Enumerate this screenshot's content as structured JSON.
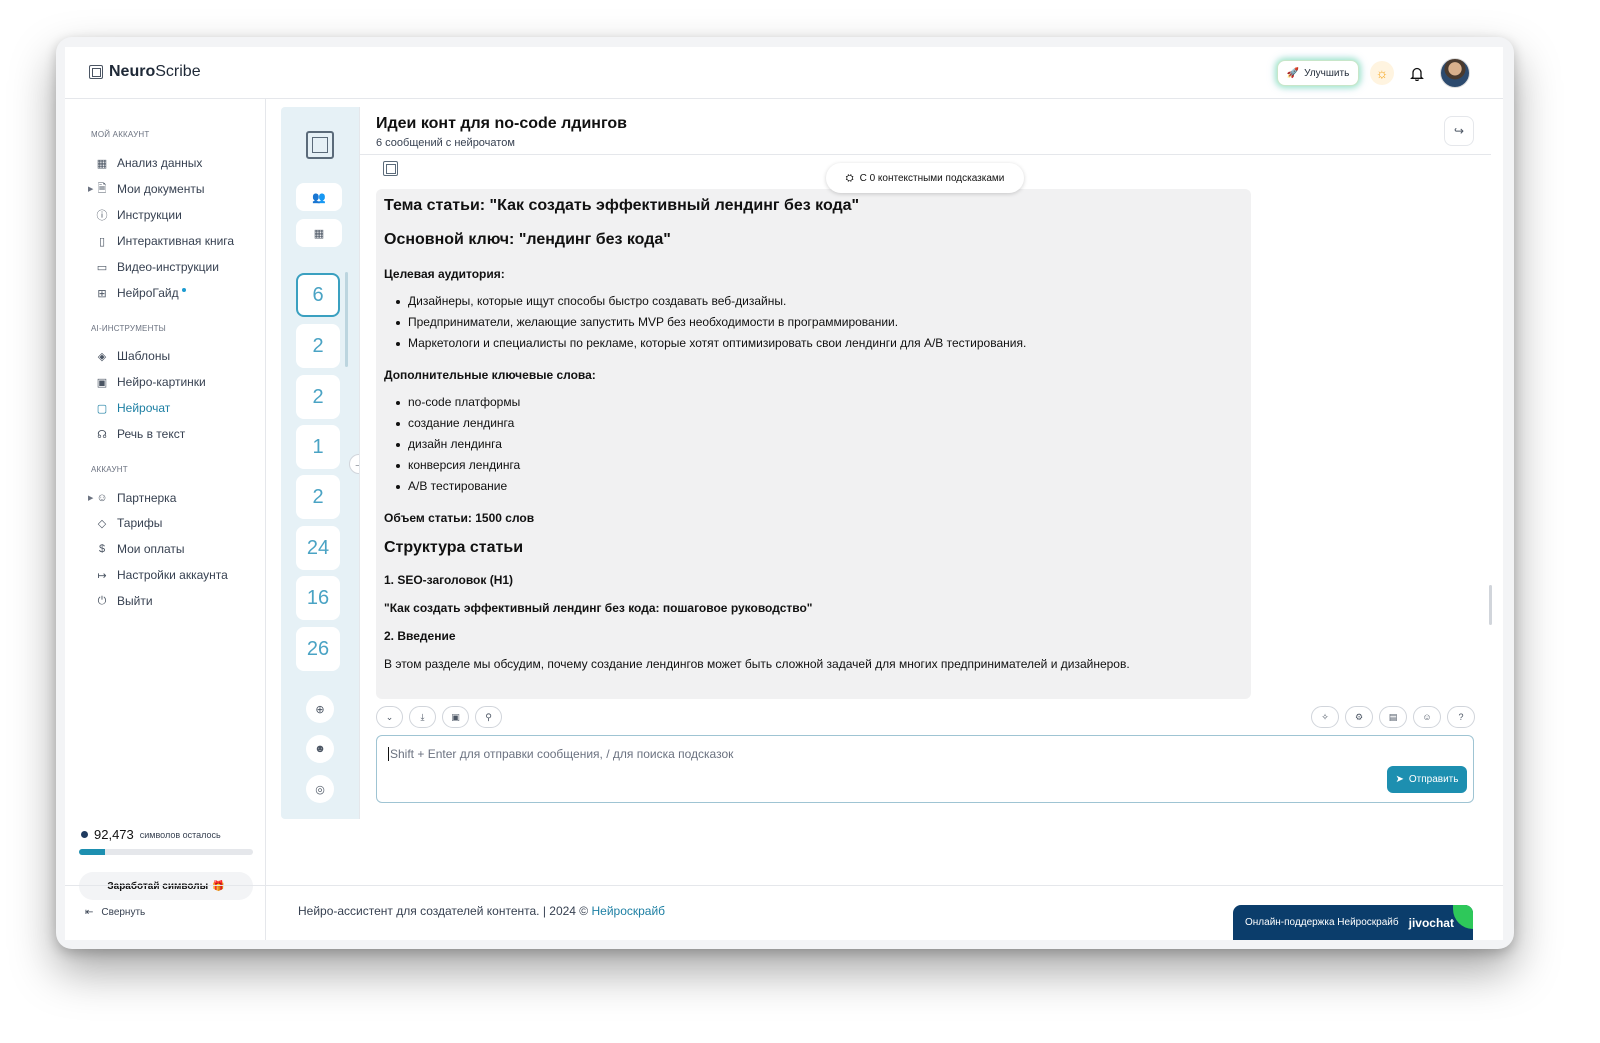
{
  "app": {
    "brand_bold": "Neuro",
    "brand_light": "Scribe",
    "upgrade_label": "Улучшить"
  },
  "sidebar": {
    "sections": [
      {
        "title": "МОЙ АККАУНТ",
        "items": [
          {
            "label": "Анализ данных",
            "icon": "grid-icon"
          },
          {
            "label": "Мои документы",
            "icon": "document-icon",
            "expandable": true
          },
          {
            "label": "Инструкции",
            "icon": "help-circle-icon"
          },
          {
            "label": "Интерактивная книга",
            "icon": "book-icon"
          },
          {
            "label": "Видео-инструкции",
            "icon": "video-icon"
          },
          {
            "label": "НейроГайд",
            "icon": "table-icon",
            "dot": true
          }
        ]
      },
      {
        "title": "AI-ИНСТРУМЕНТЫ",
        "items": [
          {
            "label": "Шаблоны",
            "icon": "layers-icon"
          },
          {
            "label": "Нейро-картинки",
            "icon": "image-icon"
          },
          {
            "label": "Нейрочат",
            "icon": "chat-icon",
            "active": true
          },
          {
            "label": "Речь в текст",
            "icon": "headphones-icon"
          }
        ]
      },
      {
        "title": "АККАУНТ",
        "items": [
          {
            "label": "Партнерка",
            "icon": "users-icon",
            "expandable": true
          },
          {
            "label": "Тарифы",
            "icon": "tag-icon"
          },
          {
            "label": "Мои оплаты",
            "icon": "dollar-icon"
          },
          {
            "label": "Настройки аккаунта",
            "icon": "logout-icon"
          },
          {
            "label": "Выйти",
            "icon": "power-icon"
          }
        ]
      }
    ],
    "credits_value": "92,473",
    "credits_text": "символов осталось",
    "credits_fraction": 0.15,
    "earn_label": "Заработай символы",
    "collapse_label": "Свернуть"
  },
  "chat_list": {
    "counts": [
      "6",
      "2",
      "2",
      "1",
      "2",
      "24",
      "16",
      "26"
    ],
    "selected_index": 0
  },
  "chat": {
    "title": "Идеи конт для no-code лдингов",
    "subtitle": "6 сообщений с нейрочатом",
    "hints_pill": "С 0 контекстными подсказками",
    "message": {
      "topic": "Тема статьи: \"Как создать эффективный лендинг без кода\"",
      "key": "Основной ключ: \"лендинг без кода\"",
      "audience_title": "Целевая аудитория:",
      "audience": [
        "Дизайнеры, которые ищут способы быстро создавать веб-дизайны.",
        "Предприниматели, желающие запустить MVP без необходимости в программировании.",
        "Маркетологи и специалисты по рекламе, которые хотят оптимизировать свои лендинги для A/B тестирования."
      ],
      "keywords_title": "Дополнительные ключевые слова:",
      "keywords": [
        "no-code платформы",
        "создание лендинга",
        "дизайн лендинга",
        "конверсия лендинга",
        "A/B тестирование"
      ],
      "volume": "Объем статьи: 1500 слов",
      "structure_title": "Структура статьи",
      "h1_label": "1. SEO-заголовок (H1)",
      "h1_text": "\"Как создать эффективный лендинг без кода: пошаговое руководство\"",
      "intro_label": "2. Введение",
      "intro_text": "В этом разделе мы обсудим, почему создание лендингов может быть сложной задачей для многих предпринимателей и дизайнеров."
    },
    "input_placeholder": "Shift + Enter для отправки сообщения, / для поиска подсказок",
    "send_label": "Отправить"
  },
  "footer": {
    "text": "Нейро-ассистент для создателей контента.  | 2024 © ",
    "link": "Нейроскрайб"
  },
  "support": {
    "label": "Онлайн-поддержка Нейроскрайб",
    "brand": "jivochat"
  },
  "colors": {
    "accent": "#1d8fb0",
    "sidebar_active": "#1d7fa3",
    "chatlist_bg": "#e6f1f6",
    "jivo_bg": "#0b3d6b"
  }
}
